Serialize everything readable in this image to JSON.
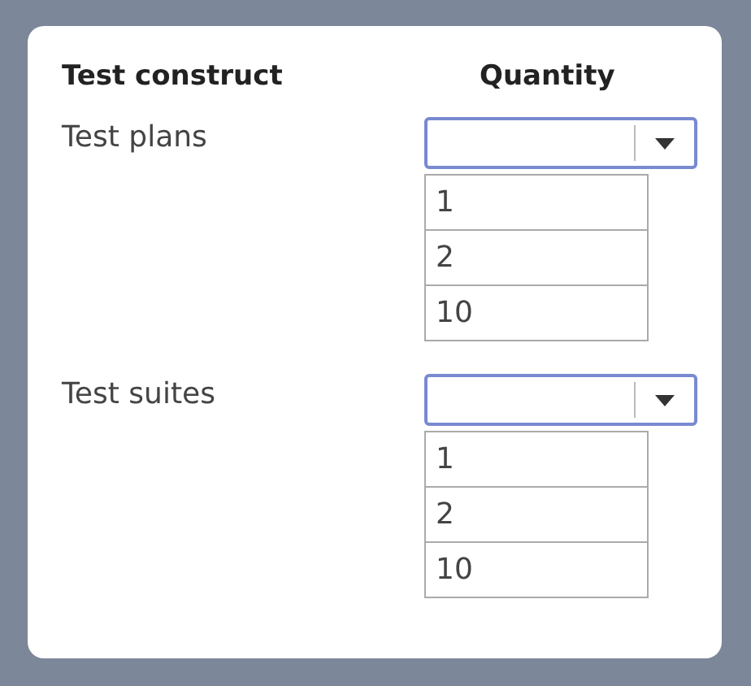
{
  "columns": [
    {
      "label": "Test construct"
    },
    {
      "label": "Quantity"
    }
  ],
  "rows": [
    {
      "label": "Test plans",
      "options": [
        "1",
        "2",
        "10"
      ]
    },
    {
      "label": "Test suites",
      "options": [
        "1",
        "2",
        "10"
      ]
    }
  ]
}
